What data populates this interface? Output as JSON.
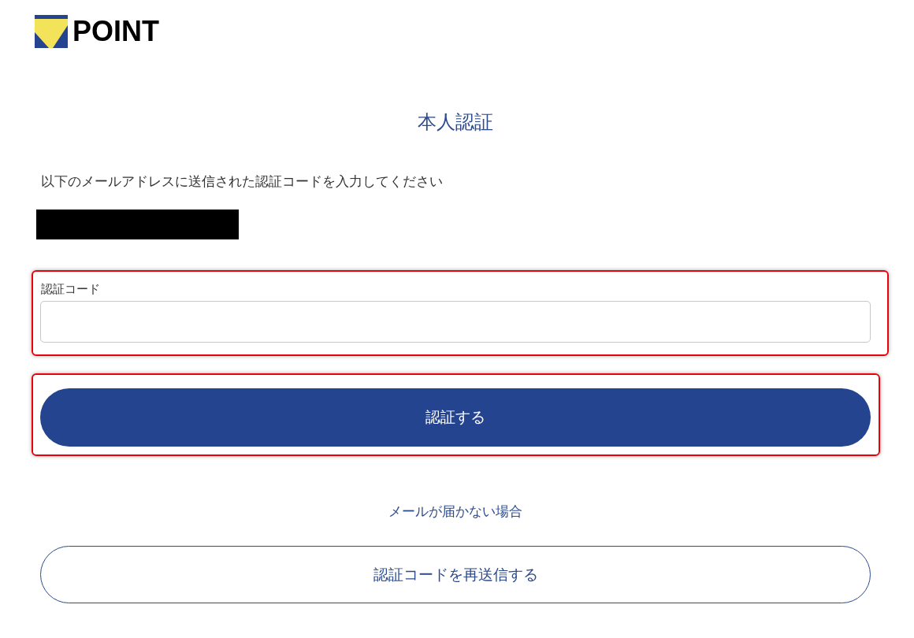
{
  "header": {
    "logo_text": "POINT"
  },
  "title": "本人認証",
  "instruction": "以下のメールアドレスに送信された認証コードを入力してください",
  "code_field": {
    "label": "認証コード",
    "highlighted": true
  },
  "submit_button": {
    "label": "認証する",
    "highlighted": true
  },
  "resend_section": {
    "heading": "メールが届かない場合",
    "button": "認証コードを再送信する"
  }
}
